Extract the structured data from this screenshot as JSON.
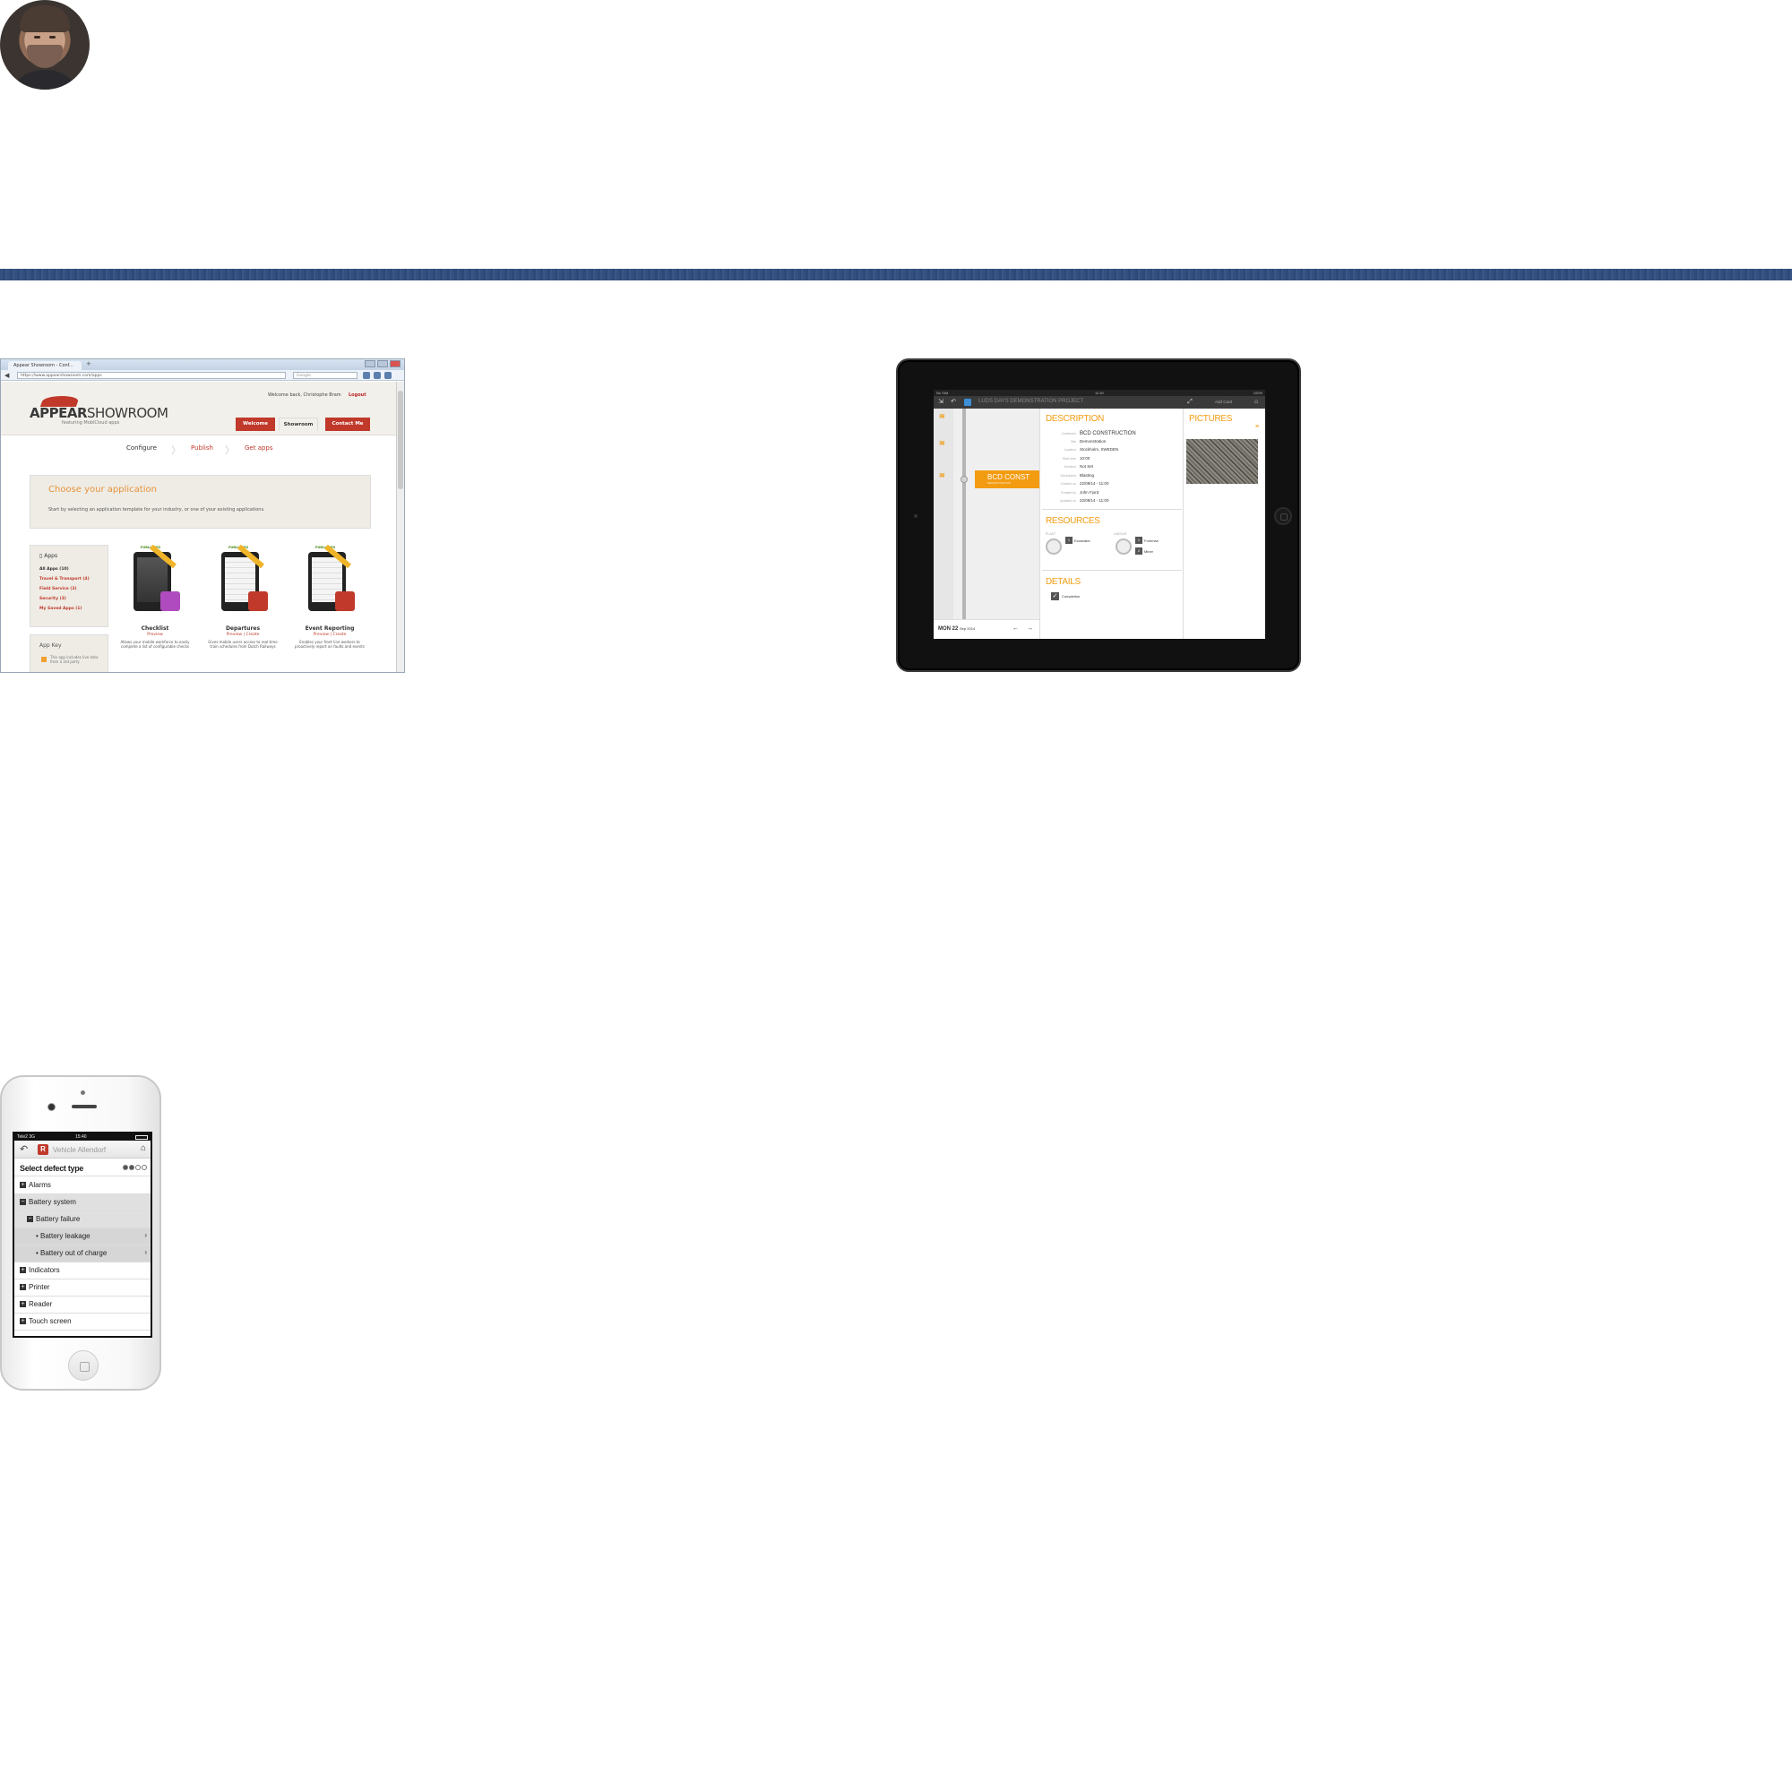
{
  "browser": {
    "tab_title": "Appear Showroom - Conf...",
    "url": "https://www.appearshowroom.com/apps",
    "search_placeholder": "Google",
    "welcome_text": "Welcome back, Christophe Bram",
    "logout_label": "Logout",
    "logo_main": "APPEAR",
    "logo_accent": "SHOWROOM",
    "logo_sub": "featuring MobiCloud apps",
    "nav": [
      "Welcome",
      "Showroom",
      "Contact Me"
    ],
    "steps": [
      "Configure",
      "Publish",
      "Get apps"
    ],
    "choose_title": "Choose your application",
    "choose_text": "Start by selecting an application template for your industry, or one of your existing applications.",
    "apps_title": "Apps",
    "apps_items": [
      "All Apps (10)",
      "Travel & Transport (4)",
      "Field Service (3)",
      "Security (3)",
      "My Saved Apps (1)"
    ],
    "appkey_title": "App Key",
    "appkey_text": "This app includes live data from a 3rd party",
    "apps": [
      {
        "badge": "PUBLISHED",
        "name": "Checklist",
        "links": "Preview",
        "desc": "Allows your mobile workforce to easily complete a list of configurable checks",
        "icon_color": "#b04bbf"
      },
      {
        "badge": "PUBLISHED",
        "name": "Departures",
        "links": "Preview | Create",
        "desc": "Gives mobile users access to real-time train schedules from Dutch Railways",
        "icon_color": "#c0392b"
      },
      {
        "badge": "PUBLISHED",
        "name": "Event Reporting",
        "links": "Preview | Create",
        "desc": "Enables your front line workers to proactively report on faults and events",
        "icon_color": "#c0392b"
      }
    ]
  },
  "tablet": {
    "status_left": "No SIM",
    "status_center": "11:30",
    "status_right": "100%",
    "title": "LUDS DAYS DEMONSTRATION PROJECT",
    "toolbar_context": "Add Card",
    "timeline_tag": "BCD CONST",
    "timeline_tag_sub": "DEMONSTRATION",
    "date_label": "MON 22",
    "date_sub": "Sep 2014",
    "description_title": "DESCRIPTION",
    "fields": [
      {
        "k": "Contractor",
        "v": "BCD CONSTRUCTION"
      },
      {
        "k": "Site",
        "v": "Demonstration"
      },
      {
        "k": "Location",
        "v": "Stockholm, SWEDEN"
      },
      {
        "k": "Start time",
        "v": "10:00"
      },
      {
        "k": "Duration",
        "v": "Not Set"
      },
      {
        "k": "Description",
        "v": "Blasting"
      },
      {
        "k": "Created on",
        "v": "22/09/14 - 11:00"
      },
      {
        "k": "Created by",
        "v": "John Fjord"
      },
      {
        "k": "Updated on",
        "v": "22/09/14 - 11:00"
      }
    ],
    "resources_title": "RESOURCES",
    "res_col_plant": "PLANT",
    "res_col_labour": "LABOUR",
    "resources": [
      {
        "n": "1",
        "name": "Excavator"
      },
      {
        "n": "1",
        "name": "Foreman"
      },
      {
        "n": "2",
        "name": "Miner"
      }
    ],
    "details_title": "DETAILS",
    "details_check": "Completion",
    "pictures_title": "PICTURES"
  },
  "phone": {
    "carrier": "Tele2 3G",
    "time": "15:40",
    "title": "Vehicle Allendorf",
    "subheader": "Select defect type",
    "progress_steps": 4,
    "progress_current": 2,
    "rows": [
      {
        "label": "Alarms",
        "type": "closed"
      },
      {
        "label": "Battery system",
        "type": "open"
      },
      {
        "label": "Battery failure",
        "type": "open-sub"
      },
      {
        "label": "Battery leakage",
        "type": "leaf"
      },
      {
        "label": "Battery out of charge",
        "type": "leaf"
      },
      {
        "label": "Indicators",
        "type": "closed"
      },
      {
        "label": "Printer",
        "type": "closed"
      },
      {
        "label": "Reader",
        "type": "closed"
      },
      {
        "label": "Touch screen",
        "type": "closed"
      }
    ]
  }
}
